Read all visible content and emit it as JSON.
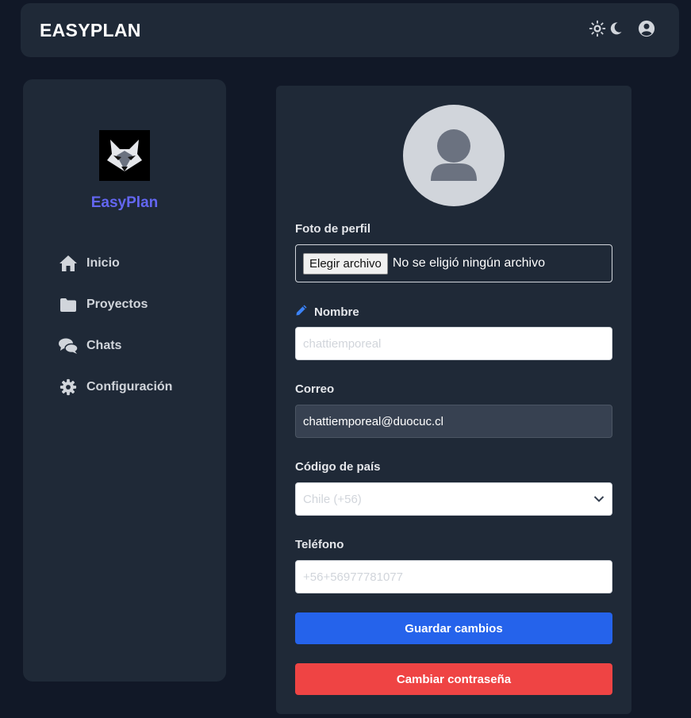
{
  "header": {
    "brand": "EASYPLAN",
    "icons": [
      "sun-icon",
      "moon-icon",
      "user-circle-icon"
    ]
  },
  "sidebar": {
    "brand": "EasyPlan",
    "logo": "wolf-logo",
    "items": [
      {
        "label": "Inicio",
        "icon": "home-icon"
      },
      {
        "label": "Proyectos",
        "icon": "folder-icon"
      },
      {
        "label": "Chats",
        "icon": "chat-icon"
      },
      {
        "label": "Configuración",
        "icon": "gear-icon"
      }
    ]
  },
  "profile": {
    "photo_label": "Foto de perfil",
    "file_button": "Elegir archivo",
    "file_status": "No se eligió ningún archivo",
    "name_label": "Nombre",
    "name_placeholder": "chattiemporeal",
    "email_label": "Correo",
    "email_value": "chattiemporeal@duocuc.cl",
    "country_label": "Código de país",
    "country_value": "Chile (+56)",
    "phone_label": "Teléfono",
    "phone_placeholder": "+56+56977781077",
    "save_button": "Guardar cambios",
    "password_button": "Cambiar contraseña"
  },
  "colors": {
    "background": "#111827",
    "panel": "#1f2937",
    "accent_brand": "#6366f1",
    "primary_button": "#2563eb",
    "danger_button": "#ef4444"
  }
}
